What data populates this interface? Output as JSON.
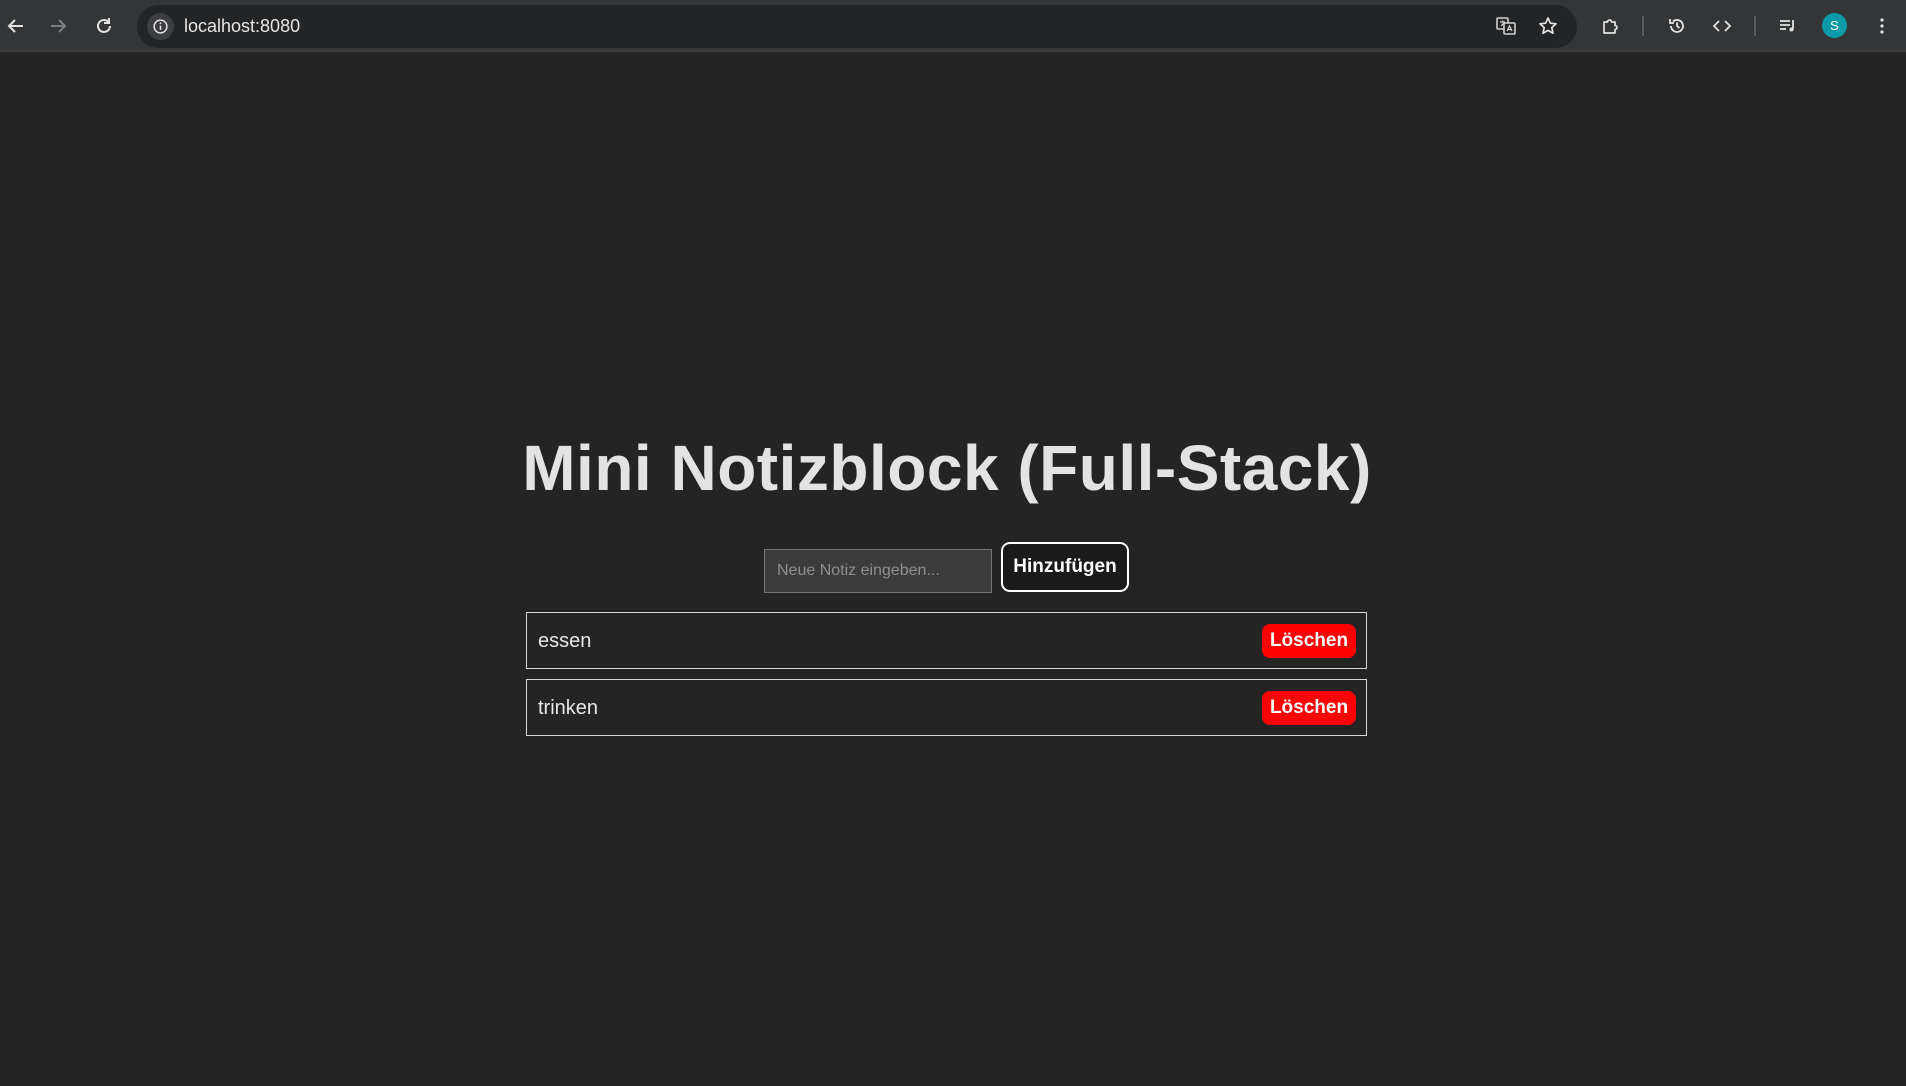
{
  "browser": {
    "url": "localhost:8080",
    "profile_initial": "S",
    "icons": {
      "back": "back-arrow-icon",
      "forward": "forward-arrow-icon",
      "reload": "reload-icon",
      "site_info": "info-icon",
      "translate": "translate-icon",
      "bookmark": "star-icon",
      "extensions": "puzzle-icon",
      "history": "history-icon",
      "devtools": "code-icon",
      "reading_list": "media-list-icon"
    },
    "colors": {
      "toolbar": "#333537",
      "omnibox": "#232426",
      "avatar": "#0b9aa8"
    }
  },
  "app": {
    "title": "Mini Notizblock (Full-Stack)",
    "input_placeholder": "Neue Notiz eingeben...",
    "input_value": "",
    "add_label": "Hinzufügen",
    "notes": [
      {
        "text": "essen",
        "delete_label": "Löschen"
      },
      {
        "text": "trinken",
        "delete_label": "Löschen"
      }
    ],
    "colors": {
      "background": "#242424",
      "delete_button": "#ff0000",
      "title": "#e3e3e3"
    }
  }
}
